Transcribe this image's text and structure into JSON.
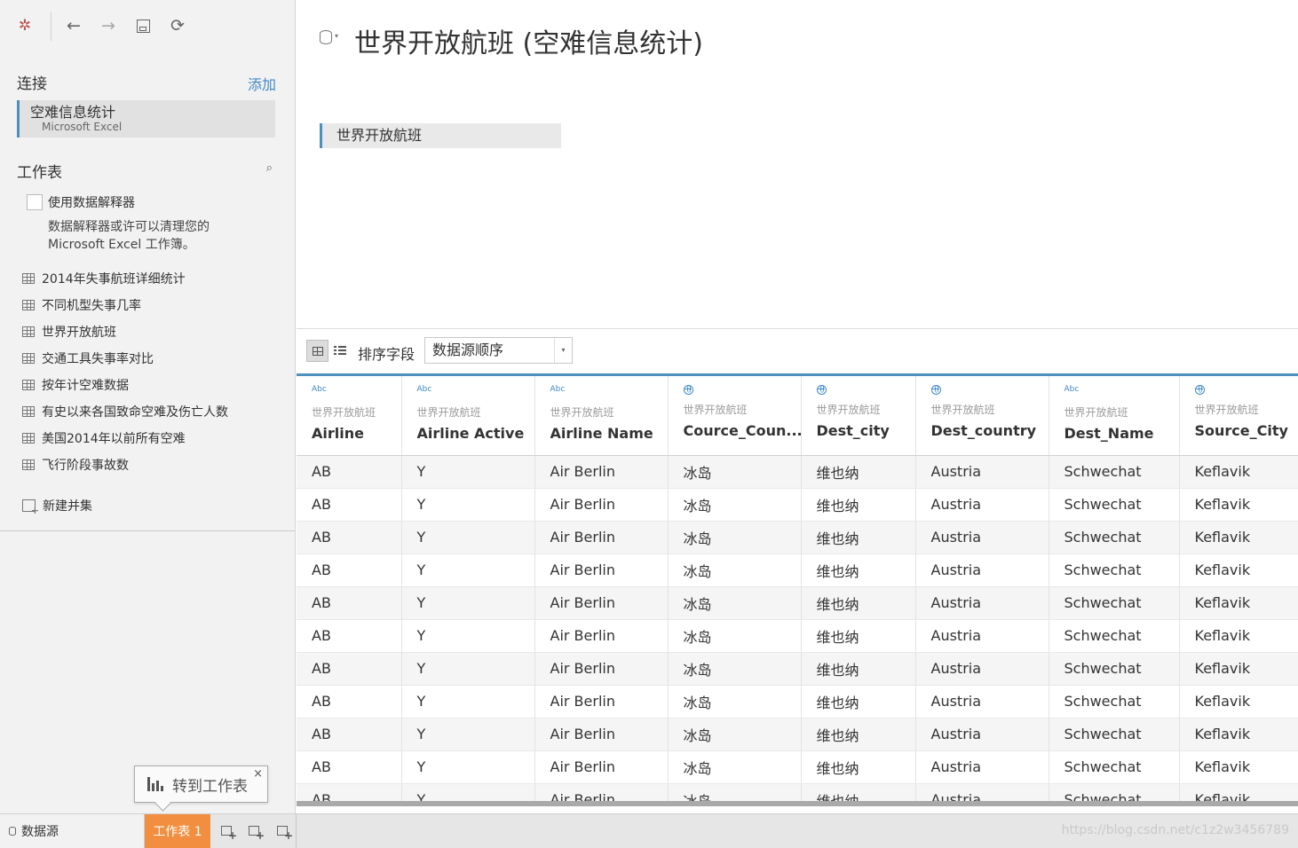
{
  "toolbar": {
    "logo_icon": "tableau-logo-icon",
    "back_icon": "arrow-left-icon",
    "forward_icon": "arrow-right-icon",
    "save_icon": "save-icon",
    "refresh_icon": "refresh-icon",
    "back_glyph": "←",
    "forward_glyph": "→",
    "save_glyph": "🖫",
    "refresh_glyph": "⟳",
    "logo_glyph": "✲"
  },
  "connections": {
    "title": "连接",
    "add_label": "添加",
    "items": [
      {
        "name": "空难信息统计",
        "type": "Microsoft Excel"
      }
    ]
  },
  "worksheets": {
    "title": "工作表",
    "search_glyph": "⌕",
    "interpreter_label": "使用数据解释器",
    "interpreter_desc": "数据解释器或许可以清理您的 Microsoft Excel 工作簿。",
    "items": [
      "2014年失事航班详细统计",
      "不同机型失事几率",
      "世界开放航班",
      "交通工具失事率对比",
      "按年计空难数据",
      "有史以来各国致命空难及伤亡人数",
      "美国2014年以前所有空难",
      "飞行阶段事故数"
    ],
    "new_union": "新建并集"
  },
  "tooltip": {
    "label": "转到工作表",
    "close_glyph": "×"
  },
  "datasource": {
    "title": "世界开放航班 (空难信息统计)",
    "caret_glyph": "▾",
    "canvas_table": "世界开放航班"
  },
  "grid_toolbar": {
    "sort_label": "排序字段",
    "sort_value": "数据源顺序",
    "sort_caret": "▾"
  },
  "grid": {
    "columns": [
      {
        "type": "Abc",
        "source": "世界开放航班",
        "name": "Airline"
      },
      {
        "type": "Abc",
        "source": "世界开放航班",
        "name": "Airline Active"
      },
      {
        "type": "Abc",
        "source": "世界开放航班",
        "name": "Airline Name"
      },
      {
        "type": "geo",
        "source": "世界开放航班",
        "name": "Cource_Coun..."
      },
      {
        "type": "geo",
        "source": "世界开放航班",
        "name": "Dest_city"
      },
      {
        "type": "geo",
        "source": "世界开放航班",
        "name": "Dest_country"
      },
      {
        "type": "Abc",
        "source": "世界开放航班",
        "name": "Dest_Name"
      },
      {
        "type": "geo",
        "source": "世界开放航班",
        "name": "Source_City"
      }
    ],
    "rows": [
      [
        "AB",
        "Y",
        "Air Berlin",
        "冰岛",
        "维也纳",
        "Austria",
        "Schwechat",
        "Keflavik"
      ],
      [
        "AB",
        "Y",
        "Air Berlin",
        "冰岛",
        "维也纳",
        "Austria",
        "Schwechat",
        "Keflavik"
      ],
      [
        "AB",
        "Y",
        "Air Berlin",
        "冰岛",
        "维也纳",
        "Austria",
        "Schwechat",
        "Keflavik"
      ],
      [
        "AB",
        "Y",
        "Air Berlin",
        "冰岛",
        "维也纳",
        "Austria",
        "Schwechat",
        "Keflavik"
      ],
      [
        "AB",
        "Y",
        "Air Berlin",
        "冰岛",
        "维也纳",
        "Austria",
        "Schwechat",
        "Keflavik"
      ],
      [
        "AB",
        "Y",
        "Air Berlin",
        "冰岛",
        "维也纳",
        "Austria",
        "Schwechat",
        "Keflavik"
      ],
      [
        "AB",
        "Y",
        "Air Berlin",
        "冰岛",
        "维也纳",
        "Austria",
        "Schwechat",
        "Keflavik"
      ],
      [
        "AB",
        "Y",
        "Air Berlin",
        "冰岛",
        "维也纳",
        "Austria",
        "Schwechat",
        "Keflavik"
      ],
      [
        "AB",
        "Y",
        "Air Berlin",
        "冰岛",
        "维也纳",
        "Austria",
        "Schwechat",
        "Keflavik"
      ],
      [
        "AB",
        "Y",
        "Air Berlin",
        "冰岛",
        "维也纳",
        "Austria",
        "Schwechat",
        "Keflavik"
      ],
      [
        "AB",
        "Y",
        "Air Berlin",
        "冰岛",
        "维也纳",
        "Austria",
        "Schwechat",
        "Keflavik"
      ]
    ]
  },
  "tabs": {
    "datasource_label": "数据源",
    "sheet1_label": "工作表 1",
    "active_color": "#f28e3f"
  },
  "watermark": "https://blog.csdn.net/c1z2w3456789",
  "accent_color": "#4d8fbf",
  "link_color": "#3f89c5"
}
